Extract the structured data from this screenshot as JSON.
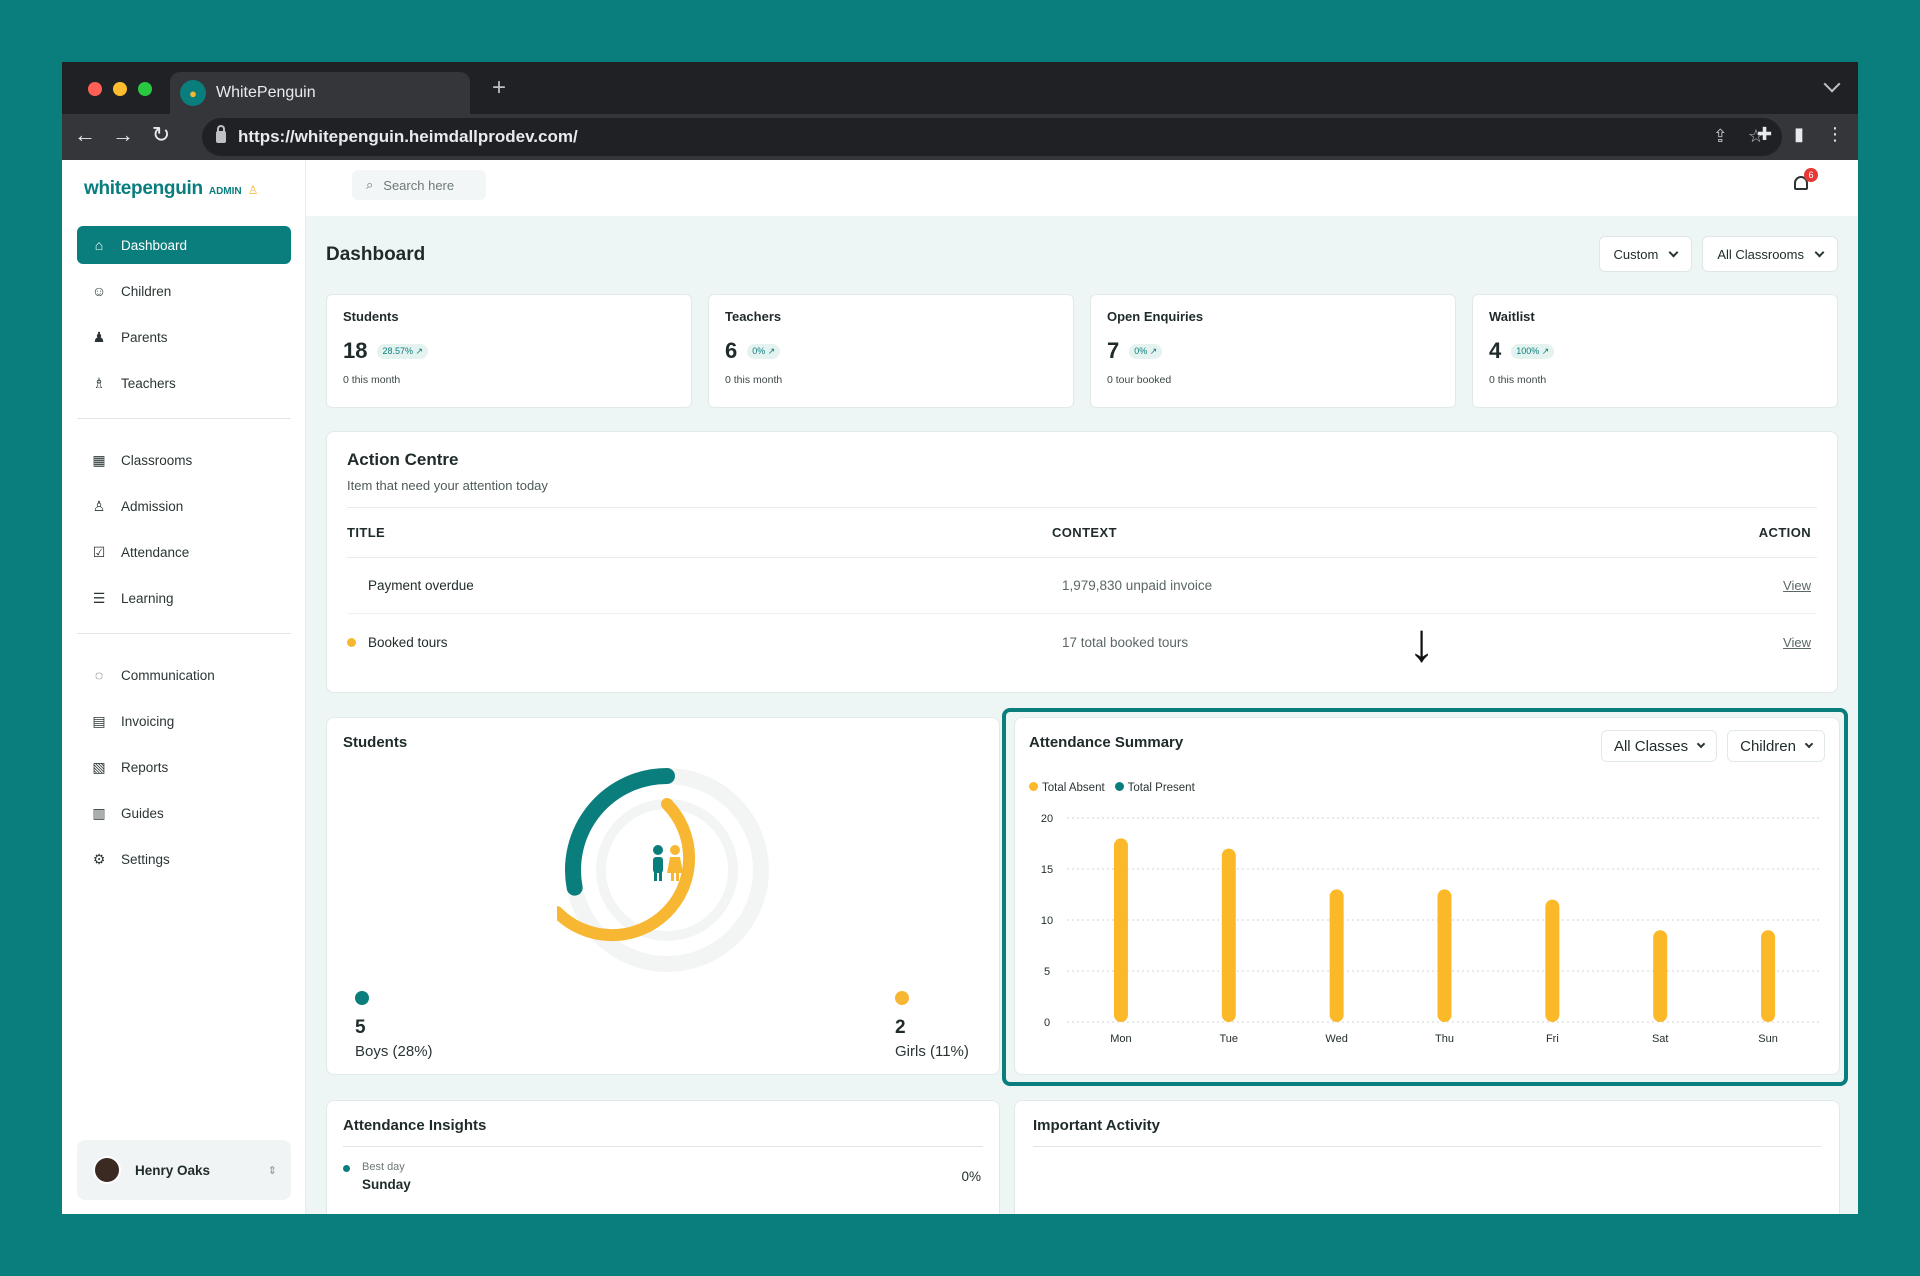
{
  "browser": {
    "tab_title": "WhitePenguin",
    "url": "https://whitepenguin.heimdallprodev.com/"
  },
  "brand": {
    "name": "whitepenguin",
    "badge": "ADMIN"
  },
  "sidebar": {
    "items": [
      {
        "label": "Dashboard",
        "icon": "dashboard-icon",
        "active": true
      },
      {
        "label": "Children",
        "icon": "child-icon"
      },
      {
        "label": "Parents",
        "icon": "parents-icon"
      },
      {
        "label": "Teachers",
        "icon": "teacher-icon"
      },
      {
        "label": "Classrooms",
        "icon": "grid-icon"
      },
      {
        "label": "Admission",
        "icon": "user-add-icon"
      },
      {
        "label": "Attendance",
        "icon": "check-square-icon"
      },
      {
        "label": "Learning",
        "icon": "book-icon"
      },
      {
        "label": "Communication",
        "icon": "chat-icon"
      },
      {
        "label": "Invoicing",
        "icon": "invoice-icon"
      },
      {
        "label": "Reports",
        "icon": "chart-icon"
      },
      {
        "label": "Guides",
        "icon": "guide-icon"
      },
      {
        "label": "Settings",
        "icon": "gear-icon"
      }
    ],
    "user": "Henry Oaks"
  },
  "topbar": {
    "search_placeholder": "Search here",
    "notifications": "6"
  },
  "page": {
    "title": "Dashboard",
    "filter_period": "Custom",
    "filter_classrooms": "All Classrooms"
  },
  "stats": [
    {
      "label": "Students",
      "value": "18",
      "change": "28.57% ↗",
      "sub": "0 this month"
    },
    {
      "label": "Teachers",
      "value": "6",
      "change": "0% ↗",
      "sub": "0 this month"
    },
    {
      "label": "Open Enquiries",
      "value": "7",
      "change": "0% ↗",
      "sub": "0 tour booked"
    },
    {
      "label": "Waitlist",
      "value": "4",
      "change": "100% ↗",
      "sub": "0 this month"
    }
  ],
  "action_centre": {
    "title": "Action Centre",
    "subtitle": "Item that need your attention today",
    "headers": [
      "TITLE",
      "CONTEXT",
      "ACTION"
    ],
    "rows": [
      {
        "title": "Payment overdue",
        "context": "1,979,830 unpaid invoice",
        "action": "View",
        "dot": ""
      },
      {
        "title": "Booked tours",
        "context": "17 total booked tours",
        "action": "View",
        "dot": "#f7b733"
      }
    ]
  },
  "students_card": {
    "title": "Students",
    "boys_count": "5",
    "boys_label": "Boys (28%)",
    "girls_count": "2",
    "girls_label": "Girls (11%)",
    "boys_fraction": 0.28,
    "girls_fraction": 0.11,
    "boys_color": "#0a7d7d",
    "girls_color": "#f7b733"
  },
  "attendance": {
    "title": "Attendance Summary",
    "filter_class": "All Classes",
    "filter_group": "Children"
  },
  "chart_data": {
    "type": "bar",
    "categories": [
      "Mon",
      "Tue",
      "Wed",
      "Thu",
      "Fri",
      "Sat",
      "Sun"
    ],
    "series": [
      {
        "name": "Total Absent",
        "color": "#fbb829",
        "values": [
          18,
          17,
          13,
          13,
          12,
          9,
          9
        ]
      },
      {
        "name": "Total Present",
        "color": "#0a7d7d",
        "values": [
          0,
          0,
          0,
          0,
          0,
          0,
          0
        ]
      }
    ],
    "ylim": [
      0,
      20
    ],
    "yticks": [
      "0",
      "5",
      "10",
      "15",
      "20"
    ],
    "grid": true,
    "legend": "top-left"
  },
  "insights": {
    "title": "Attendance Insights",
    "best_label": "Best day",
    "best_day": "Sunday",
    "best_pct": "0%"
  },
  "activity": {
    "title": "Important Activity"
  }
}
